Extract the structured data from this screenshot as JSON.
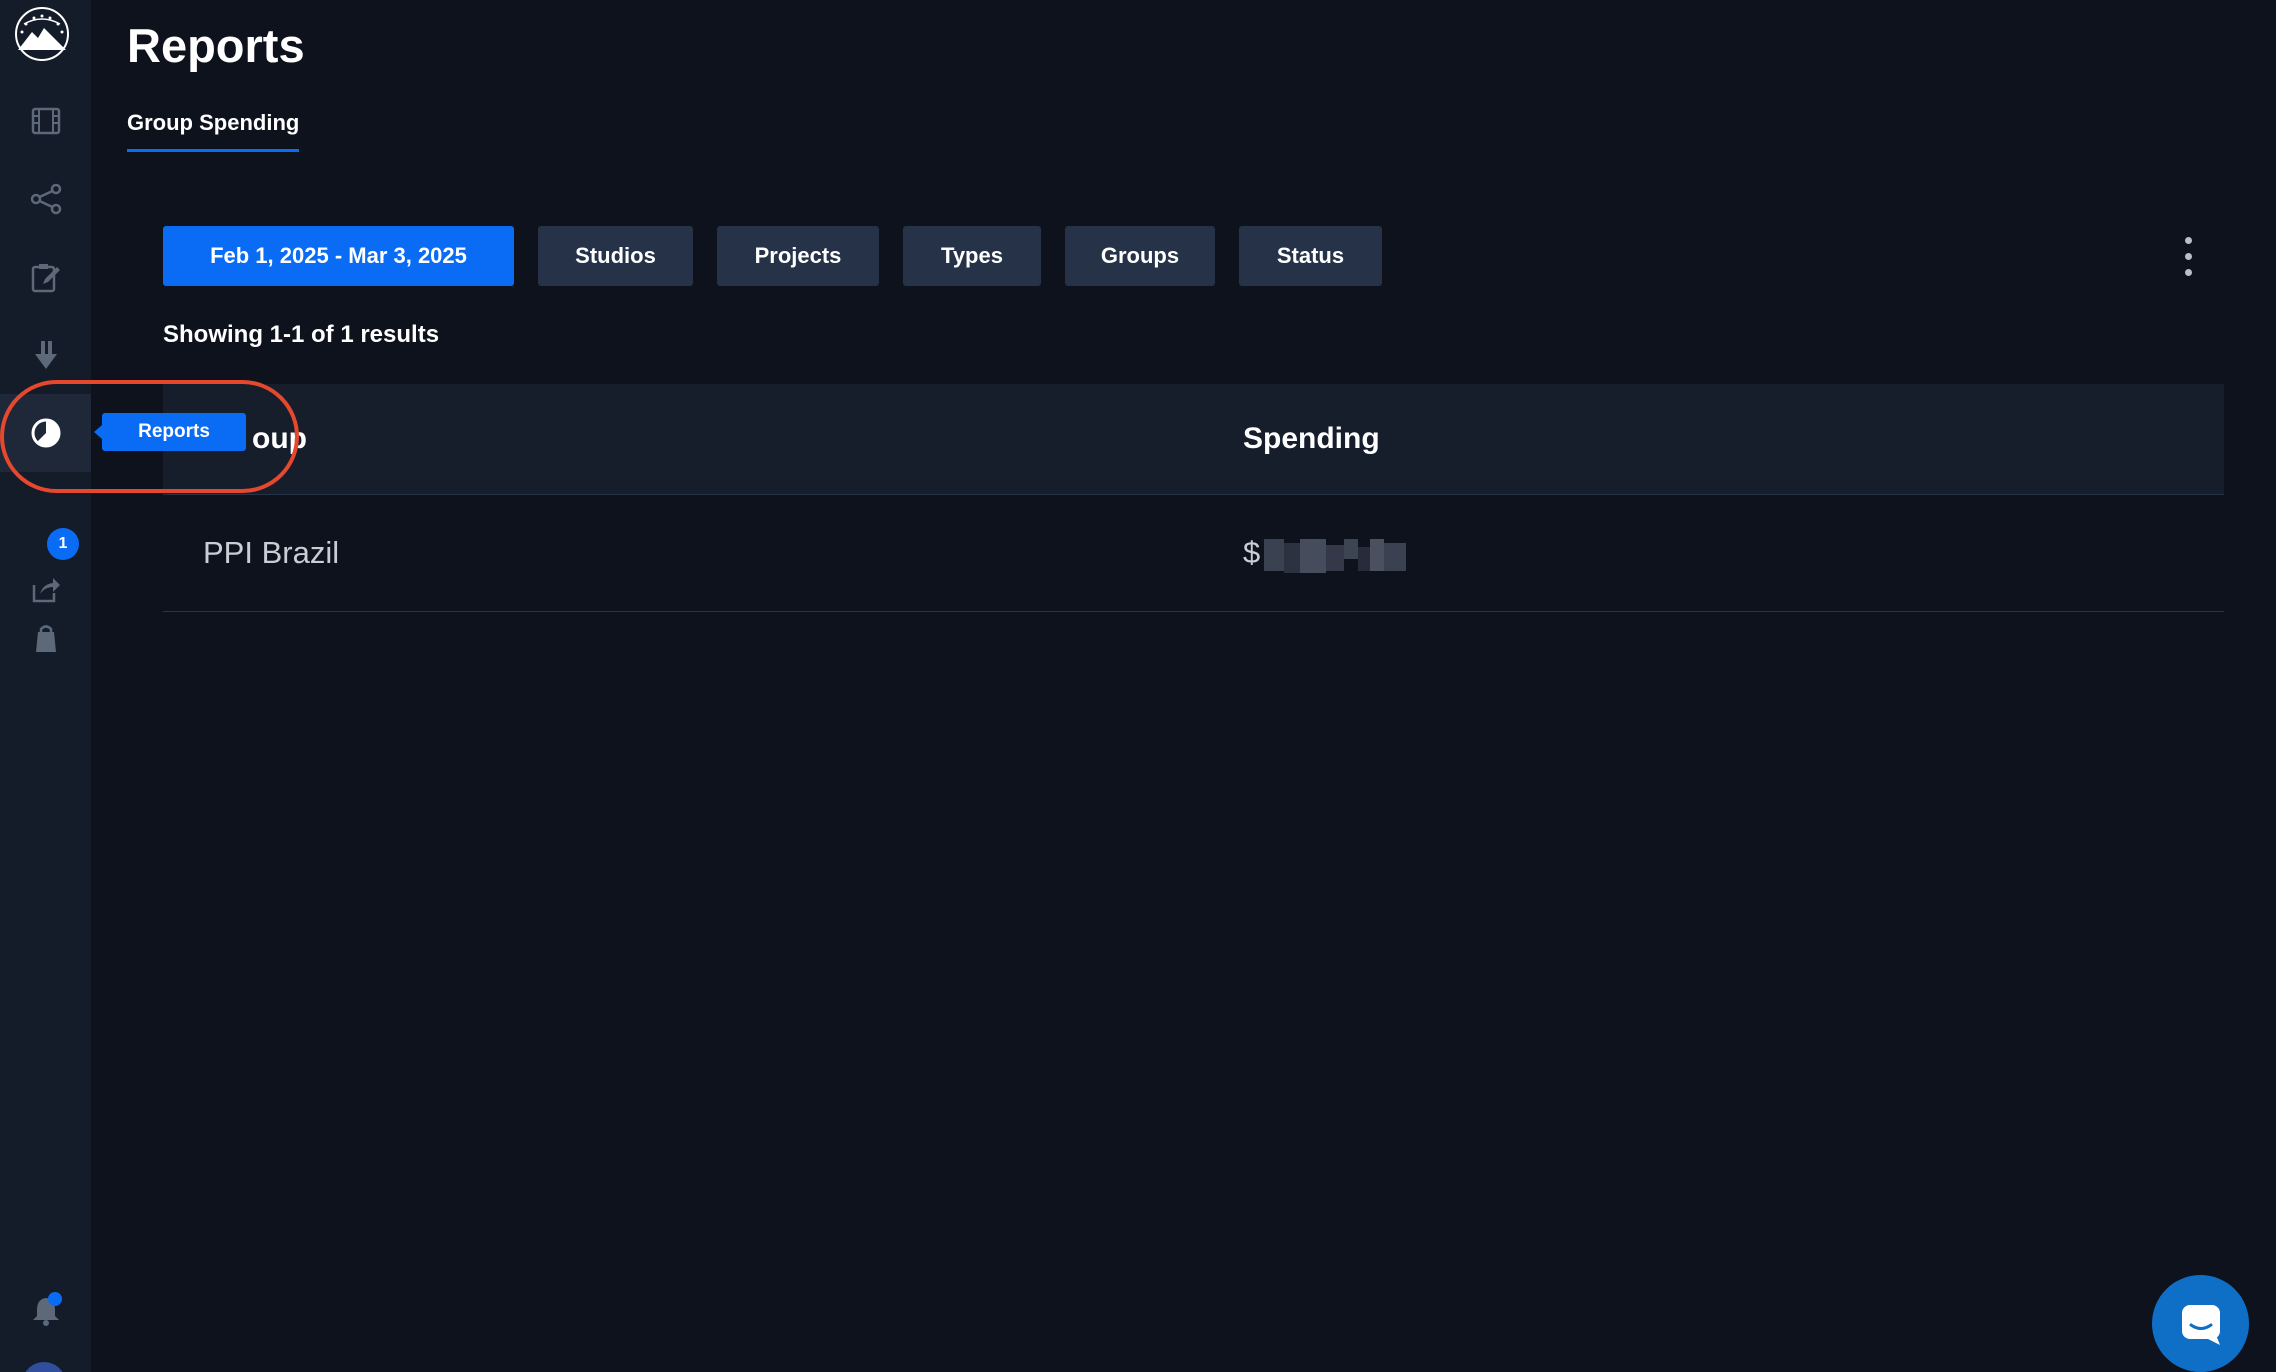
{
  "page": {
    "title": "Reports"
  },
  "tabs": [
    {
      "label": "Group Spending",
      "active": true
    }
  ],
  "filters": {
    "date_range": "Feb 1, 2025 - Mar 3, 2025",
    "studios": "Studios",
    "projects": "Projects",
    "types": "Types",
    "groups": "Groups",
    "status": "Status"
  },
  "results_text": "Showing 1-1 of 1 results",
  "table": {
    "columns": [
      "Group",
      "Spending"
    ],
    "visible_group_header": "oup",
    "rows": [
      {
        "group": "PPI Brazil",
        "spending": "$"
      }
    ]
  },
  "sidebar": {
    "items": [
      {
        "icon": "film-icon"
      },
      {
        "icon": "share-icon"
      },
      {
        "icon": "clipboard-edit-icon"
      },
      {
        "icon": "download-icon"
      },
      {
        "icon": "pie-chart-icon",
        "active": true
      },
      {
        "icon": "export-icon",
        "badge": "1"
      },
      {
        "icon": "shopping-bag-icon"
      }
    ],
    "tooltip": "Reports"
  },
  "colors": {
    "accent": "#0a6cf5",
    "background": "#0d121c",
    "sidebar": "#141b29",
    "filter_button": "#253247",
    "annotation": "#e5482c"
  }
}
